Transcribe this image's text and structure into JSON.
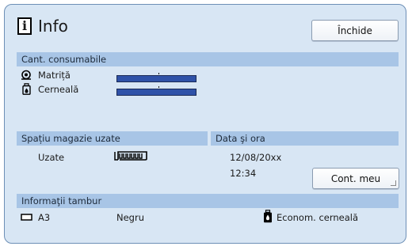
{
  "window": {
    "title": "Info",
    "close_label": "Închide"
  },
  "consumables": {
    "header": "Cant. consumabile",
    "master": {
      "label": "Matriță",
      "level": 1.0,
      "icon": "master-roll-icon"
    },
    "ink": {
      "label": "Cerneală",
      "level": 1.0,
      "icon": "ink-bottle-icon"
    }
  },
  "disposal": {
    "header": "Spațiu magazie uzate",
    "label": "Uzate",
    "icon": "disposal-box-icon"
  },
  "datetime": {
    "header": "Data şi ora",
    "date": "12/08/20xx",
    "time": "12:34",
    "account_label": "Cont. meu"
  },
  "drum": {
    "header": "Informaţii tambur",
    "paper_size": "A3",
    "paper_icon": "paper-size-icon",
    "color": "Negru",
    "ink_saving": "Econom. cerneală",
    "ink_saving_icon": "ink-save-icon"
  },
  "colors": {
    "panel_bg": "#d8e6f4",
    "header_bg": "#a8c5e6",
    "level_fill": "#2f52a8",
    "border": "#6d8fb6"
  }
}
